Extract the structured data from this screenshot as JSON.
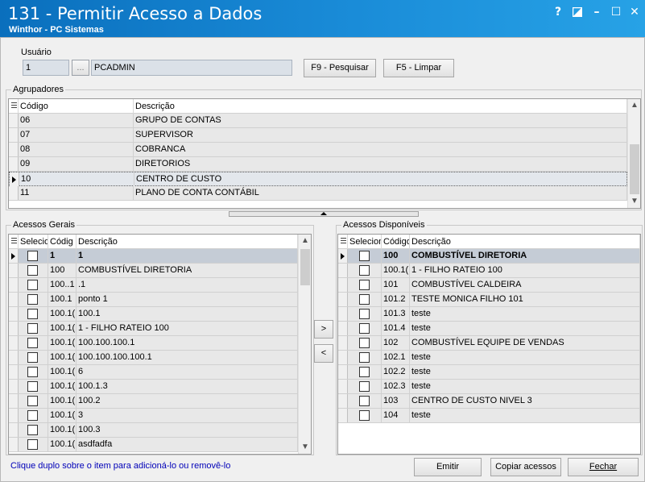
{
  "window": {
    "title": "131 - Permitir Acesso a Dados",
    "subtitle": "Winthor - PC Sistemas",
    "help_label": "?",
    "minimize_label": "–",
    "maximize_label": "☐",
    "close_label": "✕"
  },
  "usuario": {
    "label": "Usuário",
    "code": "1",
    "lookup_label": "...",
    "name": "PCADMIN",
    "search_button": "F9 - Pesquisar",
    "clear_button": "F5 - Limpar"
  },
  "agrupadores": {
    "title": "Agrupadores",
    "columns": [
      "Código",
      "Descrição"
    ],
    "rows": [
      {
        "codigo": "06",
        "descricao": "GRUPO DE CONTAS"
      },
      {
        "codigo": "07",
        "descricao": "SUPERVISOR"
      },
      {
        "codigo": "08",
        "descricao": "COBRANCA"
      },
      {
        "codigo": "09",
        "descricao": "DIRETORIOS"
      },
      {
        "codigo": "10",
        "descricao": "CENTRO DE CUSTO"
      },
      {
        "codigo": "11",
        "descricao": "PLANO DE CONTA CONTÁBIL"
      }
    ],
    "current_row": 4
  },
  "acessos_gerais": {
    "title": "Acessos Gerais",
    "columns": [
      "Selecio",
      "Códig",
      "Descrição"
    ],
    "rows": [
      {
        "codigo": "1",
        "descricao": "1"
      },
      {
        "codigo": "100",
        "descricao": "COMBUSTÍVEL DIRETORIA"
      },
      {
        "codigo": "100..1",
        "descricao": ".1"
      },
      {
        "codigo": "100.1",
        "descricao": "ponto 1"
      },
      {
        "codigo": "100.1(",
        "descricao": "100.1"
      },
      {
        "codigo": "100.1(",
        "descricao": "1 - FILHO RATEIO 100"
      },
      {
        "codigo": "100.1(",
        "descricao": "100.100.100.1"
      },
      {
        "codigo": "100.1(",
        "descricao": "100.100.100.100.1"
      },
      {
        "codigo": "100.1(",
        "descricao": "6"
      },
      {
        "codigo": "100.1(",
        "descricao": "100.1.3"
      },
      {
        "codigo": "100.1(",
        "descricao": "100.2"
      },
      {
        "codigo": "100.1(",
        "descricao": "3"
      },
      {
        "codigo": "100.1(",
        "descricao": "100.3"
      },
      {
        "codigo": "100.1(",
        "descricao": "asdfadfa"
      }
    ]
  },
  "acessos_disponiveis": {
    "title": "Acessos Disponíveis",
    "columns": [
      "Selecion",
      "Código",
      "Descrição"
    ],
    "rows": [
      {
        "codigo": "100",
        "descricao": "COMBUSTÍVEL DIRETORIA"
      },
      {
        "codigo": "100.1(",
        "descricao": "1 - FILHO RATEIO 100"
      },
      {
        "codigo": "101",
        "descricao": "COMBUSTÍVEL CALDEIRA"
      },
      {
        "codigo": "101.2",
        "descricao": "TESTE MONICA FILHO 101"
      },
      {
        "codigo": "101.3",
        "descricao": "teste"
      },
      {
        "codigo": "101.4",
        "descricao": "teste"
      },
      {
        "codigo": "102",
        "descricao": "COMBUSTÍVEL EQUIPE DE VENDAS"
      },
      {
        "codigo": "102.1",
        "descricao": "teste"
      },
      {
        "codigo": "102.2",
        "descricao": "teste"
      },
      {
        "codigo": "102.3",
        "descricao": "teste"
      },
      {
        "codigo": "103",
        "descricao": "CENTRO DE CUSTO NIVEL 3"
      },
      {
        "codigo": "104",
        "descricao": "teste"
      }
    ]
  },
  "transfer": {
    "add_label": ">",
    "remove_label": "<"
  },
  "footer": {
    "hint": "Clique duplo sobre o item para adicioná-lo ou removê-lo",
    "emitir": "Emitir",
    "copiar": "Copiar acessos",
    "fechar": "Fechar"
  }
}
